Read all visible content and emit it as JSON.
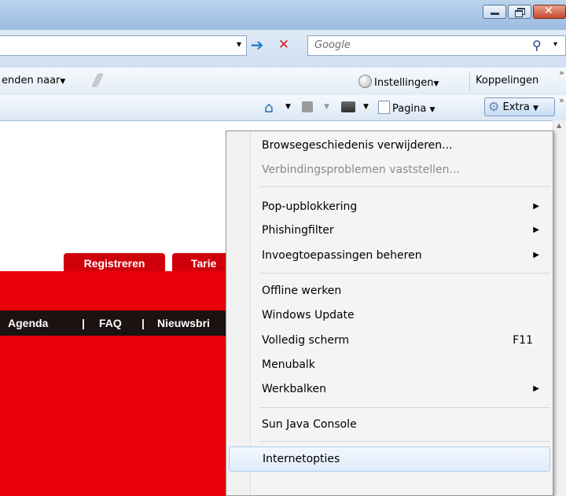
{
  "colors": {
    "page_red": "#e8000b",
    "nav_dark": "#1c1212",
    "menu_bg": "#f4f4f4",
    "hover": "#e1ecfa"
  },
  "window": {
    "minimize_icon": "minimize-icon",
    "restore_icon": "restore-icon",
    "close_icon": "close-icon"
  },
  "address_bar": {
    "dropdown_glyph": "▾",
    "go_glyph": "➔",
    "stop_glyph": "✕",
    "search_placeholder": "Google",
    "search_glyph": "⚲"
  },
  "links_bar": {
    "send_label": "enden naar",
    "settings_label": "Instellingen",
    "links_label": "Koppelingen",
    "overflow": "»"
  },
  "command_bar": {
    "page_label": "Pagina",
    "tools_label": "Extra",
    "overflow": "»"
  },
  "page": {
    "tabs": [
      "Registreren",
      "Tarie"
    ],
    "nav": [
      "Agenda",
      "|",
      "FAQ",
      "|",
      "Nieuwsbri"
    ]
  },
  "menu": {
    "items": [
      {
        "label": "Browsegeschiedenis verwijderen...",
        "disabled": false
      },
      {
        "label": "Verbindingsproblemen vaststellen...",
        "disabled": true
      },
      {
        "label": "Pop-upblokkering",
        "submenu": true
      },
      {
        "label": "Phishingfilter",
        "submenu": true
      },
      {
        "label": "Invoegtoepassingen beheren",
        "submenu": true
      },
      {
        "label": "Offline werken"
      },
      {
        "label": "Windows Update"
      },
      {
        "label": "Volledig scherm",
        "shortcut": "F11"
      },
      {
        "label": "Menubalk"
      },
      {
        "label": "Werkbalken",
        "submenu": true
      },
      {
        "label": "Sun Java Console"
      },
      {
        "label": "Internetopties",
        "highlighted": true
      }
    ],
    "arrow_glyph": "▶"
  }
}
